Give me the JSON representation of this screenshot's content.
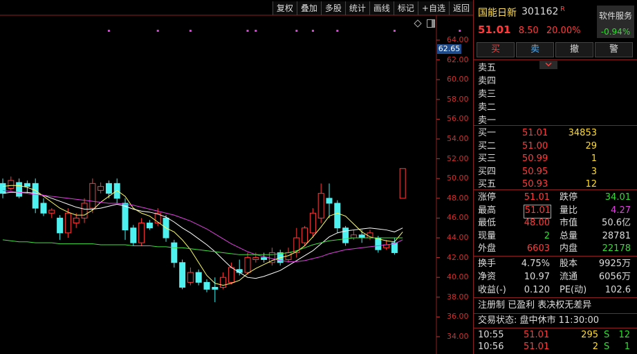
{
  "toolbar": [
    "复权",
    "叠加",
    "多股",
    "统计",
    "画线",
    "标记",
    "+自选",
    "返回"
  ],
  "price_axis": [
    "64.00",
    "62.00",
    "60.00",
    "58.00",
    "56.00",
    "54.00",
    "52.00",
    "50.00",
    "48.00",
    "46.00",
    "44.00",
    "42.00",
    "40.00",
    "38.00",
    "36.00",
    "34.00"
  ],
  "current_price_tag": "62.65",
  "stock": {
    "name": "国能日新",
    "code": "301162",
    "badge": "R",
    "price": "51.01",
    "change": "8.50",
    "change_pct": "20.00%"
  },
  "service": {
    "label": "软件服务",
    "pct": "-0.94%"
  },
  "trade_buttons": [
    "买",
    "卖",
    "撤",
    "警"
  ],
  "sell_levels": [
    "卖五",
    "卖四",
    "卖三",
    "卖二",
    "卖一"
  ],
  "buy_levels": [
    {
      "label": "买一",
      "price": "51.01",
      "vol": "34853"
    },
    {
      "label": "买二",
      "price": "51.00",
      "vol": "29"
    },
    {
      "label": "买三",
      "price": "50.99",
      "vol": "1"
    },
    {
      "label": "买四",
      "price": "50.95",
      "vol": "3"
    },
    {
      "label": "买五",
      "price": "50.93",
      "vol": "12"
    }
  ],
  "stats": {
    "zhangting": "51.01",
    "dieting": "34.01",
    "zuigao": "51.01",
    "liangbi": "4.27",
    "zuidi": "48.00",
    "shizhi": "50.6亿",
    "xianliang": "2",
    "zongliang": "28781",
    "waipan": "6603",
    "neipan": "22178",
    "huanshou": "4.75%",
    "guben": "9925万",
    "jingzi": "10.97",
    "liutong": "6056万",
    "shouyi": "0.120",
    "pe": "102.6"
  },
  "labels": {
    "zhangting": "涨停",
    "dieting": "跌停",
    "zuigao": "最高",
    "liangbi": "量比",
    "zuidi": "最低",
    "shizhi": "市值",
    "xianliang": "现量",
    "zongliang": "总量",
    "waipan": "外盘",
    "neipan": "内盘",
    "huanshou": "换手",
    "guben": "股本",
    "jingzi": "净资",
    "liutong": "流通",
    "shouyi": "收益(-)",
    "pe": "PE(动)"
  },
  "notice": "注册制 已盈利 表决权无差异",
  "status": "交易状态: 盘中休市 11:30:00",
  "ticks": [
    {
      "time": "10:55",
      "price": "51.01",
      "vol": "295",
      "side": "S",
      "num": "12"
    },
    {
      "time": "10:56",
      "price": "51.01",
      "vol": "2",
      "side": "S",
      "num": "1"
    }
  ],
  "chart_data": {
    "type": "candlestick",
    "ylim": [
      34,
      64
    ],
    "candles": [
      {
        "o": 49.5,
        "c": 48.5,
        "h": 50,
        "l": 48
      },
      {
        "o": 49,
        "c": 49.8,
        "h": 50.2,
        "l": 48.8
      },
      {
        "o": 49.6,
        "c": 48.2,
        "h": 50,
        "l": 48
      },
      {
        "o": 49.5,
        "c": 49.2,
        "h": 49.8,
        "l": 48.5
      },
      {
        "o": 49.5,
        "c": 47,
        "h": 50,
        "l": 46.5
      },
      {
        "o": 47.5,
        "c": 46.5,
        "h": 48,
        "l": 46.2
      },
      {
        "o": 46.5,
        "c": 46.8,
        "h": 47,
        "l": 46
      },
      {
        "o": 46,
        "c": 44.5,
        "h": 46.3,
        "l": 43.8
      },
      {
        "o": 44.5,
        "c": 46.5,
        "h": 47,
        "l": 44
      },
      {
        "o": 45.5,
        "c": 46,
        "h": 46.5,
        "l": 45
      },
      {
        "o": 46,
        "c": 47.5,
        "h": 48,
        "l": 45.5
      },
      {
        "o": 47,
        "c": 49.5,
        "h": 50,
        "l": 46.5
      },
      {
        "o": 48.8,
        "c": 49.2,
        "h": 49.6,
        "l": 48.5
      },
      {
        "o": 49.5,
        "c": 48.5,
        "h": 49.8,
        "l": 48
      },
      {
        "o": 49.5,
        "c": 48,
        "h": 50,
        "l": 47.5
      },
      {
        "o": 47.5,
        "c": 44.8,
        "h": 48,
        "l": 43.8
      },
      {
        "o": 45,
        "c": 43.5,
        "h": 45.3,
        "l": 43.2
      },
      {
        "o": 43.5,
        "c": 45.5,
        "h": 46,
        "l": 43.2
      },
      {
        "o": 45.5,
        "c": 45,
        "h": 45.8,
        "l": 44.8
      },
      {
        "o": 45.5,
        "c": 46.5,
        "h": 47,
        "l": 45.2
      },
      {
        "o": 46,
        "c": 44,
        "h": 46.3,
        "l": 43.6
      },
      {
        "o": 43.5,
        "c": 41.5,
        "h": 43.8,
        "l": 41
      },
      {
        "o": 41.5,
        "c": 39,
        "h": 41.8,
        "l": 38.8
      },
      {
        "o": 39.5,
        "c": 40.5,
        "h": 41,
        "l": 39.2
      },
      {
        "o": 40.5,
        "c": 39.5,
        "h": 40.8,
        "l": 39.2
      },
      {
        "o": 39.5,
        "c": 38.8,
        "h": 39.8,
        "l": 38.5
      },
      {
        "o": 39,
        "c": 38.8,
        "h": 40,
        "l": 37.5
      },
      {
        "o": 39,
        "c": 40,
        "h": 40.5,
        "l": 38.8
      },
      {
        "o": 39.5,
        "c": 41,
        "h": 41.5,
        "l": 39.3
      },
      {
        "o": 40.8,
        "c": 40.5,
        "h": 41.8,
        "l": 40.2
      },
      {
        "o": 40.5,
        "c": 42,
        "h": 42.5,
        "l": 40.3
      },
      {
        "o": 41.8,
        "c": 42,
        "h": 42.5,
        "l": 41.5
      },
      {
        "o": 42,
        "c": 41.8,
        "h": 42.5,
        "l": 41.5
      },
      {
        "o": 41.5,
        "c": 42.5,
        "h": 43,
        "l": 41.2
      },
      {
        "o": 42.5,
        "c": 41.5,
        "h": 42.8,
        "l": 41.2
      },
      {
        "o": 41.8,
        "c": 42.5,
        "h": 43,
        "l": 41.5
      },
      {
        "o": 42.5,
        "c": 44,
        "h": 45,
        "l": 42
      },
      {
        "o": 43.5,
        "c": 45,
        "h": 45.2,
        "l": 43.2
      },
      {
        "o": 44.5,
        "c": 46.5,
        "h": 47,
        "l": 44
      },
      {
        "o": 46,
        "c": 48.5,
        "h": 49.5,
        "l": 45.5
      },
      {
        "o": 48,
        "c": 47.5,
        "h": 49.5,
        "l": 46
      },
      {
        "o": 47.5,
        "c": 45,
        "h": 47.8,
        "l": 44.5
      },
      {
        "o": 45,
        "c": 43.5,
        "h": 45.2,
        "l": 43.2
      },
      {
        "o": 44,
        "c": 44.3,
        "h": 44.8,
        "l": 43.8
      },
      {
        "o": 44.3,
        "c": 44,
        "h": 44.8,
        "l": 43.5
      },
      {
        "o": 44,
        "c": 44.5,
        "h": 44.8,
        "l": 43.8
      },
      {
        "o": 44,
        "c": 42.8,
        "h": 44.2,
        "l": 42.5
      },
      {
        "o": 43,
        "c": 43.3,
        "h": 43.8,
        "l": 42.8
      },
      {
        "o": 43.5,
        "c": 42.5,
        "h": 44,
        "l": 42.3
      },
      {
        "o": 48,
        "c": 51.01,
        "h": 51.01,
        "l": 48
      }
    ],
    "ma": [
      {
        "name": "MA5",
        "color": "#ffff66",
        "values": [
          49.2,
          49.3,
          49.3,
          49.1,
          48.8,
          48.2,
          47.6,
          47,
          46.6,
          46.3,
          46.3,
          46.8,
          47.6,
          48.2,
          48.8,
          48.2,
          47,
          46.5,
          46.2,
          45.6,
          45,
          44.6,
          43.8,
          42.8,
          41.5,
          40.2,
          39.4,
          39.2,
          39.4,
          39.7,
          40.4,
          40.9,
          41.3,
          41.7,
          42,
          42.2,
          42.6,
          43.2,
          44.1,
          45.1,
          46.2,
          46.5,
          46.2,
          45.4,
          44.6,
          44.1,
          43.9,
          43.7,
          43.6,
          44.6
        ]
      },
      {
        "name": "MA10",
        "color": "#ffffff",
        "values": [
          48.5,
          48.6,
          48.6,
          48.6,
          48.5,
          48.3,
          48,
          47.7,
          47.4,
          47.1,
          46.9,
          46.9,
          47,
          47.2,
          47.4,
          47.2,
          46.9,
          46.7,
          46.6,
          46.4,
          46.1,
          45.6,
          45,
          44.5,
          43.9,
          43.3,
          42.6,
          41.8,
          41,
          40.5,
          40,
          39.9,
          40.1,
          40.4,
          40.7,
          41.2,
          41.7,
          42.2,
          42.7,
          43.4,
          44.1,
          44.5,
          44.7,
          44.8,
          44.9,
          45,
          44.9,
          44.8,
          44.6,
          45
        ]
      },
      {
        "name": "MA20",
        "color": "#e040e0",
        "values": [
          48.8,
          48.7,
          48.6,
          48.5,
          48.4,
          48.3,
          48.2,
          48.1,
          48,
          47.9,
          47.8,
          47.7,
          47.6,
          47.5,
          47.5,
          47.4,
          47.3,
          47.1,
          46.9,
          46.7,
          46.5,
          46.3,
          46,
          45.7,
          45.3,
          44.9,
          44.4,
          43.9,
          43.4,
          43,
          42.6,
          42.3,
          42.1,
          41.9,
          41.7,
          41.6,
          41.6,
          41.7,
          41.9,
          42.1,
          42.4,
          42.6,
          42.8,
          42.9,
          43,
          43.1,
          43.2,
          43.3,
          43.4,
          43.8
        ]
      },
      {
        "name": "MA60",
        "color": "#40e040",
        "values": [
          43.8,
          43.7,
          43.6,
          43.6,
          43.5,
          43.5,
          43.5,
          43.4,
          43.4,
          43.4,
          43.4,
          43.4,
          43.3,
          43.3,
          43.3,
          43.3,
          43.2,
          43.2,
          43.2,
          43.1,
          43.1,
          43,
          43,
          42.9,
          42.8,
          42.7,
          42.6,
          42.5,
          42.4,
          42.3,
          42.3,
          42.3,
          42.3,
          42.3,
          42.4,
          42.5,
          42.7,
          43,
          43.3,
          43.5,
          43.7,
          43.8,
          43.9,
          44,
          44,
          44,
          44,
          44,
          44,
          44
        ]
      }
    ],
    "markers_x": [
      13,
      19,
      23,
      30,
      31,
      36,
      38,
      41,
      48,
      56
    ]
  }
}
